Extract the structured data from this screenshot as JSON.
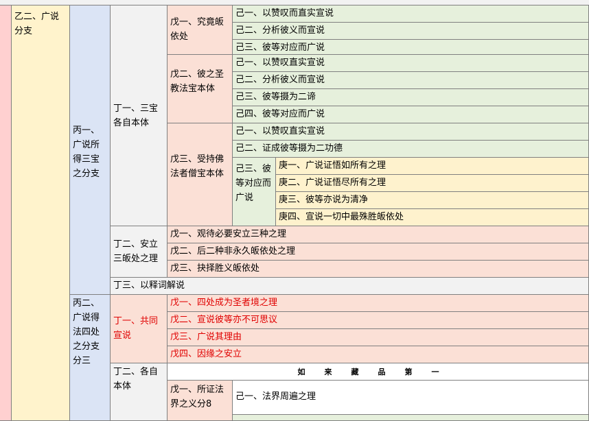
{
  "colors": {
    "pink": "#ffd0d0",
    "tan": "#fff3cc",
    "lavender": "#dbe4f5",
    "gray": "#f2f2f2",
    "peach": "#fbe0d6",
    "green": "#e6f0dc",
    "cream": "#fef2cd",
    "red_text": "#e00000"
  },
  "outline": {
    "yi2": "乙二、广说分支",
    "bing1": "丙一、广说所得三宝之分支",
    "ding1": "丁一、三宝各自本体",
    "wu1": "戊一、究竟皈依处",
    "wu1_items": [
      "己一、以赞叹而直实宣说",
      "己二、分析彼义而宣说",
      "己三、彼等对应而广说"
    ],
    "wu2": "戊二、彼之圣教法宝本体",
    "wu2_items": [
      "己一、以赞叹直实宣说",
      "己二、分析彼义而宣说",
      "己三、彼等摄为二谛",
      "己四、彼等对应而广说"
    ],
    "wu3": "戊三、受持佛法者僧宝本体",
    "wu3_items": [
      "己一、以赞叹直实宣说",
      "己二、证成彼等摄为二功德"
    ],
    "wu3_ji3": "己三、彼等对应而广说",
    "wu3_geng": [
      "庚一、广说证悟如所有之理",
      "庚二、广说证悟尽所有之理",
      "庚三、彼等亦说为清净",
      "庚四、宣说一切中最殊胜皈依处"
    ],
    "ding2": "丁二、安立三皈处之理",
    "ding2_items": [
      "戊一、观待必要安立三种之理",
      "戊二、后二种非永久皈依处之理",
      "戊三、抉择胜义皈依处"
    ],
    "ding3": "丁三、以释词解说",
    "bing2": "丙二、广说得法四处之分支分三",
    "ding1b": "丁一、共同宣说",
    "ding1b_items": [
      "戊一、四处成为圣者境之理",
      "戊二、宣说彼等亦不可思议",
      "戊三、广说其理由",
      "戊四、因缘之安立"
    ],
    "ding2b": "丁二、各自本体",
    "banner": "如来藏品第一",
    "wu1b": "戊一、所证法界之义分8",
    "wu1b_item": "己一、法界周遍之理"
  }
}
